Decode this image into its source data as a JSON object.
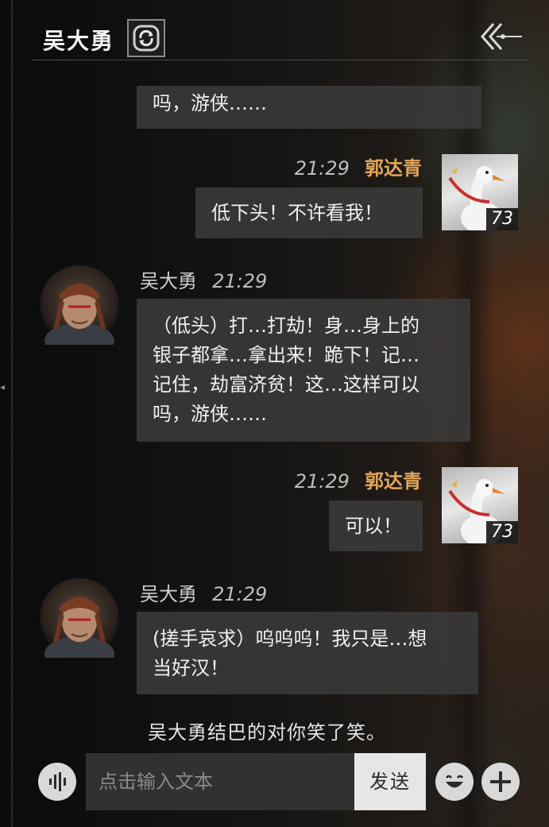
{
  "header": {
    "title": "吴大勇",
    "switch_icon": "refresh-icon",
    "back_icon": "back-arrow-icon"
  },
  "messages": [
    {
      "type": "npc_partial",
      "text": "吗，游侠……"
    },
    {
      "type": "own",
      "time": "21:29",
      "name": "郭达青",
      "level": "73",
      "text": "低下头！不许看我！"
    },
    {
      "type": "npc",
      "name": "吴大勇",
      "time": "21:29",
      "lines": [
        "（低头）打…打劫！身…身上的",
        "银子都拿…拿出来！跪下！记…",
        "记住，劫富济贫！这…这样可以",
        "吗，游侠……"
      ]
    },
    {
      "type": "own",
      "time": "21:29",
      "name": "郭达青",
      "level": "73",
      "text": "可以！"
    },
    {
      "type": "npc",
      "name": "吴大勇",
      "time": "21:29",
      "lines": [
        "(搓手哀求）呜呜呜！我只是…想",
        "当好汉！"
      ]
    }
  ],
  "system_message": "吴大勇结巴的对你笑了笑。",
  "input": {
    "placeholder": "点击输入文本",
    "value": "",
    "send_label": "发送"
  },
  "colors": {
    "own_name": "#e0a65a",
    "bubble_bg": "#3a3a3a",
    "send_bg": "#e6e6e6"
  }
}
